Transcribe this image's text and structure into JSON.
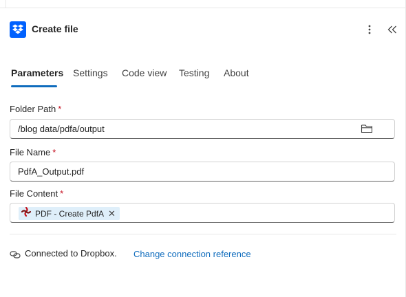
{
  "header": {
    "title": "Create file",
    "icon": "dropbox-icon",
    "more_icon": "more-vertical-icon",
    "collapse_icon": "chevron-double-left-icon"
  },
  "tabs": [
    {
      "label": "Parameters",
      "active": true
    },
    {
      "label": "Settings",
      "active": false
    },
    {
      "label": "Code view",
      "active": false
    },
    {
      "label": "Testing",
      "active": false
    },
    {
      "label": "About",
      "active": false
    }
  ],
  "fields": {
    "folder_path": {
      "label": "Folder Path",
      "required_mark": "*",
      "value": "/blog data/pdfa/output",
      "icon": "folder-icon"
    },
    "file_name": {
      "label": "File Name",
      "required_mark": "*",
      "value": "PdfA_Output.pdf"
    },
    "file_content": {
      "label": "File Content",
      "required_mark": "*",
      "token": {
        "label": "PDF - Create PdfA",
        "remove": "✕",
        "icon": "pdf-action-icon"
      }
    }
  },
  "connection": {
    "text": "Connected to Dropbox.",
    "link": "Change connection reference",
    "icon": "connection-link-icon"
  },
  "colors": {
    "accent": "#0f6cbd",
    "dropbox": "#0061fe",
    "required": "#c50f1f",
    "token_bg": "#dfeffa"
  }
}
